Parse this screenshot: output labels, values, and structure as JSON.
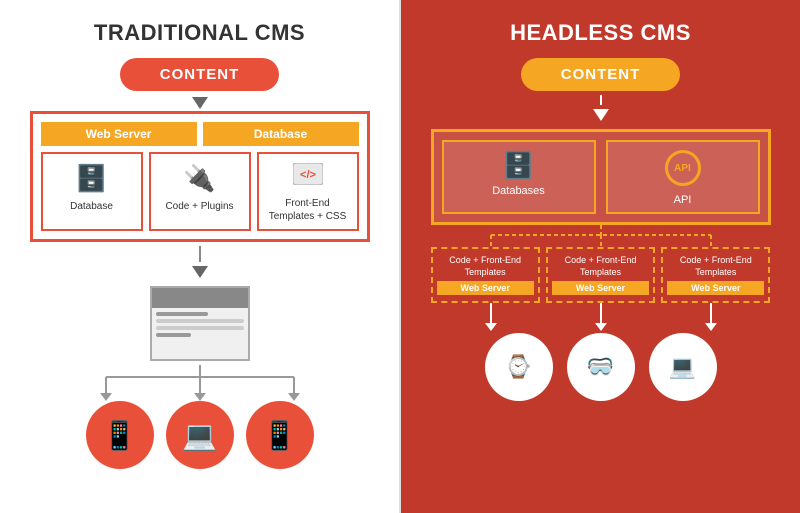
{
  "left": {
    "title": "TRADITIONAL CMS",
    "content_label": "CONTENT",
    "web_server_label": "Web Server",
    "database_label": "Database",
    "icons": [
      {
        "label": "Database",
        "icon": "db"
      },
      {
        "label": "Code + Plugins",
        "icon": "plugin"
      },
      {
        "label": "Front-End Templates + CSS",
        "icon": "code"
      }
    ],
    "devices": [
      "tablet",
      "laptop",
      "phone"
    ]
  },
  "right": {
    "title": "HEADLESS CMS",
    "content_label": "CONTENT",
    "icons": [
      {
        "label": "Databases",
        "icon": "db"
      },
      {
        "label": "API",
        "icon": "api"
      }
    ],
    "webservers": [
      {
        "text": "Code + Front-End Templates",
        "label": "Web Server"
      },
      {
        "text": "Code + Front-End Templates",
        "label": "Web Server"
      },
      {
        "text": "Code + Front-End Templates",
        "label": "Web Server"
      }
    ],
    "devices": [
      "smartwatch",
      "vr",
      "laptop"
    ]
  }
}
